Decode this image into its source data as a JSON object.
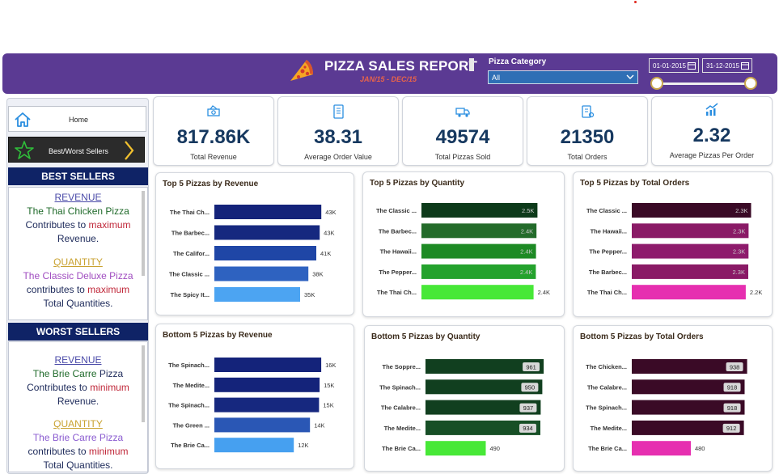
{
  "header": {
    "title": "PIZZA SALES REPORT",
    "subtitle": "JAN/15 - DEC/15",
    "category_label": "Pizza Category",
    "category_value": "All",
    "date_from": "01-01-2015",
    "date_to": "31-12-2015",
    "bg_color": "#5b3a93"
  },
  "nav": {
    "home_label": "Home",
    "bws_label": "Best/Worst Sellers"
  },
  "best": {
    "heading": "BEST SELLERS",
    "rev_label": "REVENUE",
    "rev_pizza": "The Thai Chicken Pizza",
    "rev_line1": "Contributes to ",
    "rev_em": "maximum",
    "rev_line2": "Revenue.",
    "qty_label": "QUANTITY",
    "qty_pizza": "The Classic Deluxe Pizza",
    "qty_line1": "contributes to ",
    "qty_em": "maximum",
    "qty_line2": "Total Quantities."
  },
  "worst": {
    "heading": "WORST SELLERS",
    "rev_label": "REVENUE",
    "rev_pizza_a": "The Brie Carre",
    "rev_pizza_b": " Pizza",
    "rev_line1": "Contributes to ",
    "rev_em": "minimum",
    "rev_line2": "Revenue.",
    "qty_label": "QUANTITY",
    "qty_pizza": "The Brie Carre Pizza",
    "qty_line1": "contributes to ",
    "qty_em": "minimum",
    "qty_line2": "Total Quantities."
  },
  "kpis": [
    {
      "value": "817.86K",
      "label": "Total Revenue",
      "icon": "money-icon"
    },
    {
      "value": "38.31",
      "label": "Average Order Value",
      "icon": "receipt-icon"
    },
    {
      "value": "49574",
      "label": "Total Pizzas Sold",
      "icon": "delivery-icon"
    },
    {
      "value": "21350",
      "label": "Total Orders",
      "icon": "orders-icon"
    },
    {
      "value": "2.32",
      "label": "Average Pizzas Per Order",
      "icon": "chart-up-icon"
    }
  ],
  "chart_data": [
    {
      "type": "bar",
      "orientation": "horizontal",
      "title": "Top 5 Pizzas by Revenue",
      "categories": [
        "The Thai Ch...",
        "The Barbec...",
        "The Califor...",
        "The Classic ...",
        "The Spicy It..."
      ],
      "values": [
        43434,
        42768,
        41410,
        38180,
        34831
      ],
      "data_labels": [
        "43K",
        "43K",
        "41K",
        "38K",
        "35K"
      ],
      "colors": [
        "#14237a",
        "#16287f",
        "#1f46a6",
        "#2e62c0",
        "#4ca4f2"
      ],
      "xlim": [
        0,
        46000
      ]
    },
    {
      "type": "bar",
      "orientation": "horizontal",
      "title": "Top 5 Pizzas by Quantity",
      "categories": [
        "The Classic ...",
        "The Barbec...",
        "The Hawaii...",
        "The Pepper...",
        "The Thai Ch..."
      ],
      "values": [
        2453,
        2432,
        2422,
        2418,
        2371
      ],
      "data_labels": [
        "2.5K",
        "2.4K",
        "2.4K",
        "2.4K",
        "2.4K"
      ],
      "colors": [
        "#0d3a1a",
        "#236b2a",
        "#1d8a24",
        "#24a22d",
        "#47e837"
      ],
      "xlim": [
        0,
        2600
      ]
    },
    {
      "type": "bar",
      "orientation": "horizontal",
      "title": "Top 5 Pizzas by Total Orders",
      "categories": [
        "The Classic ...",
        "The Hawaii...",
        "The Pepper...",
        "The Barbec...",
        "The Thai Ch..."
      ],
      "values": [
        2329,
        2280,
        2278,
        2273,
        2225
      ],
      "data_labels": [
        "2.3K",
        "2.3K",
        "2.3K",
        "2.3K",
        "2.2K"
      ],
      "colors": [
        "#3a0a26",
        "#8a1a66",
        "#8e1b6c",
        "#8a1a66",
        "#e62fb0"
      ],
      "xlim": [
        0,
        2400
      ]
    },
    {
      "type": "bar",
      "orientation": "horizontal",
      "title": "Bottom 5 Pizzas by Revenue",
      "categories": [
        "The Spinach...",
        "The Medite...",
        "The Spinach...",
        "The Green ...",
        "The Brie Ca..."
      ],
      "values": [
        15596,
        15360,
        15277,
        13956,
        11588
      ],
      "data_labels": [
        "16K",
        "15K",
        "15K",
        "14K",
        "12K"
      ],
      "colors": [
        "#14237a",
        "#14237a",
        "#16287f",
        "#2a57b5",
        "#46a0f0"
      ],
      "xlim": [
        0,
        17000
      ]
    },
    {
      "type": "bar",
      "orientation": "horizontal",
      "title": "Bottom 5 Pizzas by Quantity",
      "categories": [
        "The Soppre...",
        "The Spinach...",
        "The Calabre...",
        "The Medite...",
        "The Brie Ca..."
      ],
      "values": [
        961,
        950,
        937,
        934,
        490
      ],
      "data_labels": [
        "961",
        "950",
        "937",
        "934",
        "490"
      ],
      "colors": [
        "#113f1f",
        "#113f1f",
        "#113f1f",
        "#174f26",
        "#47e837"
      ],
      "xlim": [
        0,
        1000
      ]
    },
    {
      "type": "bar",
      "orientation": "horizontal",
      "title": "Bottom 5 Pizzas by Total Orders",
      "categories": [
        "The Chicken...",
        "The Calabre...",
        "The Spinach...",
        "The Medite...",
        "The Brie Ca..."
      ],
      "values": [
        938,
        918,
        918,
        912,
        480
      ],
      "data_labels": [
        "938",
        "918",
        "918",
        "912",
        "480"
      ],
      "colors": [
        "#3a0a26",
        "#3a0a26",
        "#3a0a26",
        "#3a0a26",
        "#e62fb0"
      ],
      "xlim": [
        0,
        1000
      ]
    }
  ]
}
